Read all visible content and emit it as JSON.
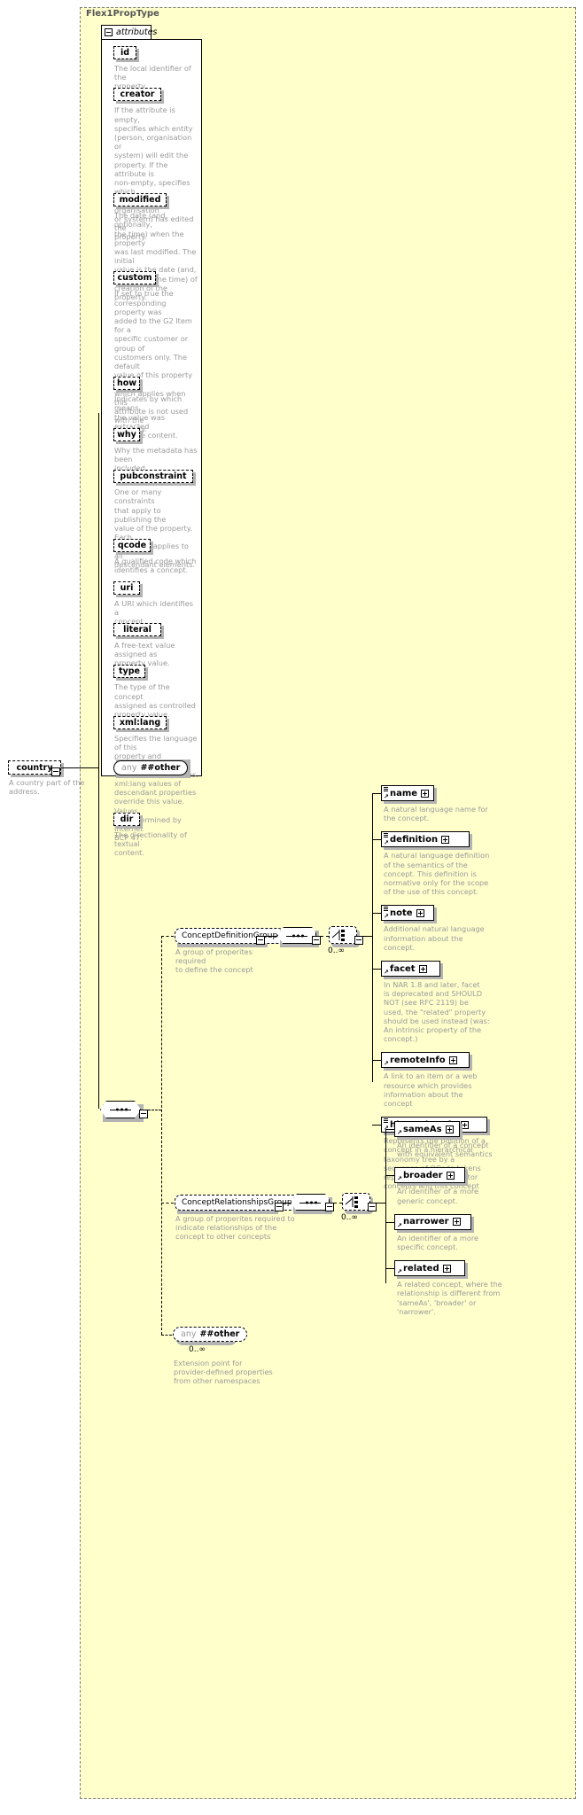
{
  "diagram": {
    "title": "Flex1PropType",
    "kind": "xsd-schema-documentation"
  },
  "attributes_section": {
    "label": "attributes",
    "toggle": "minus",
    "items": [
      {
        "name": "id",
        "desc": "The local identifier of the\nproperty."
      },
      {
        "name": "creator",
        "desc": "If the attribute is empty,\nspecifies which entity\n(person, organisation or\nsystem) will edit the\nproperty. If the attribute is\nnon-empty, specifies which\nentity (person, organisation\nor system) has edited the\nproperty."
      },
      {
        "name": "modified",
        "desc": "The date (and, optionally,\nthe time) when the property\nwas last modified. The initial\nvalue is the date (and,\noptionally, the time) of\ncreation of the property."
      },
      {
        "name": "custom",
        "desc": "If set to true the\ncorresponding property was\nadded to the G2 Item for a\nspecific customer or group of\ncustomers only. The default\nvalue of this property is false\nwhich applies when this\nattribute is not used with the\nproperty."
      },
      {
        "name": "how",
        "desc": "Indicates by which means\nthe value was extracted\nfrom the content."
      },
      {
        "name": "why",
        "desc": "Why the metadata has been\nincluded."
      },
      {
        "name": "pubconstraint",
        "desc": "One or many constraints\nthat apply to publishing the\nvalue of the property. Each\nconstraint applies to all\ndescendant elements."
      },
      {
        "name": "qcode",
        "desc": "A qualified code which\nidentifies a concept."
      },
      {
        "name": "uri",
        "desc": "A URI which identifies a\nconcept."
      },
      {
        "name": "literal",
        "desc": "A free-text value assigned as\nproperty value."
      },
      {
        "name": "type",
        "desc": "The type of the concept\nassigned as controlled\nproperty value."
      },
      {
        "name": "xml:lang",
        "desc": "Specifies the language of this\nproperty and potentially all\ndescendant properties.\nxml:lang values of\ndescendant properties\noverride this value. Values\nare determined by Internet\nBCP 47."
      },
      {
        "name": "dir",
        "desc": "The directionality of textual\ncontent."
      }
    ],
    "any_wildcard": {
      "any_label": "any",
      "namespace": "##other"
    }
  },
  "root_element": {
    "name": "country",
    "toggle": "minus",
    "desc": "A country part of the\naddress."
  },
  "content_model": {
    "root_sequence": {
      "toggle": "minus"
    },
    "groups": [
      {
        "name": "ConceptDefinitionGroup",
        "toggle": "minus",
        "desc": "A group of properites required\nto define the concept",
        "sequence_toggle": "minus",
        "choice_toggle": "minus",
        "cardinality": "0..∞",
        "elements": [
          {
            "name": "name",
            "toggle": "plus",
            "multi": true,
            "desc": "A natural language name for\nthe concept."
          },
          {
            "name": "definition",
            "toggle": "plus",
            "multi": true,
            "desc": "A natural language definition\nof the semantics of the\nconcept. This definition is\nnormative only for the scope\nof the use of this concept."
          },
          {
            "name": "note",
            "toggle": "plus",
            "multi": true,
            "desc": "Additional natural language\ninformation about the\nconcept."
          },
          {
            "name": "facet",
            "toggle": "plus",
            "multi": false,
            "desc": "In NAR 1.8 and later, facet\nis deprecated and SHOULD\nNOT (see RFC 2119) be\nused, the \"related\" property\nshould be used instead (was:\nAn intrinsic property of the\nconcept.)"
          },
          {
            "name": "remoteInfo",
            "toggle": "plus",
            "multi": false,
            "desc": "A link to an item or a web\nresource which provides\ninformation about the\nconcept"
          },
          {
            "name": "hierarchyInfo",
            "toggle": "plus",
            "multi": true,
            "desc": "Represents the position of a\nconcept in a hierarchical\ntaxonomy tree by a\nsequence of QCode tokens\nrepresenting the ancestor\nconcepts and this concept"
          }
        ]
      },
      {
        "name": "ConceptRelationshipsGroup",
        "toggle": "minus",
        "desc": "A group of properites required to\nindicate relationships of the\nconcept to other concepts",
        "sequence_toggle": "minus",
        "choice_toggle": "minus",
        "cardinality": "0..∞",
        "elements": [
          {
            "name": "sameAs",
            "toggle": "plus",
            "multi": false,
            "desc": "An identifier of a concept\nwith equivalent semantics"
          },
          {
            "name": "broader",
            "toggle": "plus",
            "multi": false,
            "desc": "An identifier of a more\ngeneric concept."
          },
          {
            "name": "narrower",
            "toggle": "plus",
            "multi": false,
            "desc": "An identifier of a more\nspecific concept."
          },
          {
            "name": "related",
            "toggle": "plus",
            "multi": false,
            "desc": "A related concept, where the\nrelationship is different from\n'sameAs', 'broader' or\n'narrower'."
          }
        ]
      }
    ],
    "trailing_any": {
      "any_label": "any",
      "namespace": "##other",
      "cardinality": "0..∞",
      "desc": "Extension point for\nprovider-defined properties\nfrom other namespaces"
    }
  },
  "colors": {
    "panel_fill": "#ffffcc",
    "panel_border": "#808080",
    "node_border": "#000000",
    "node_fill": "#ffffff",
    "desc_text": "#9a9a9a",
    "title_text": "#555555",
    "shadow": "#b3b3b3"
  }
}
